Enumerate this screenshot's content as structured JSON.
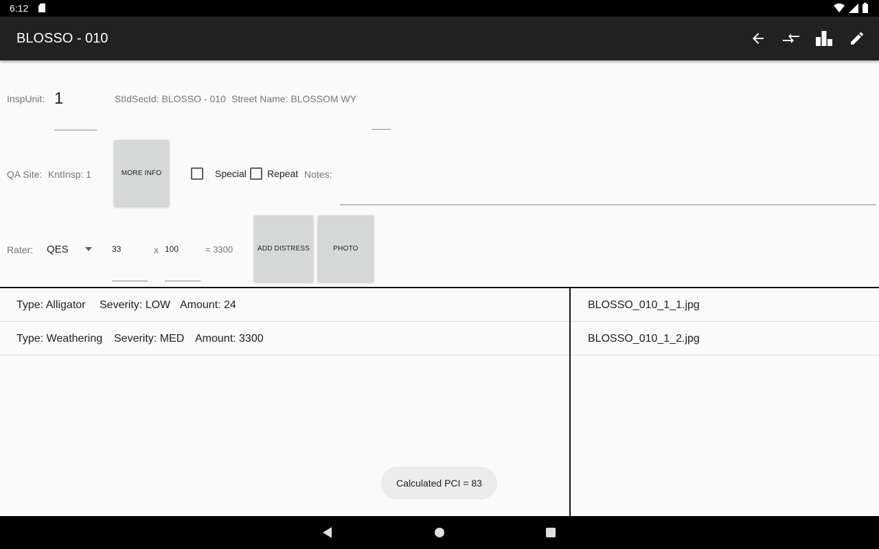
{
  "status_bar": {
    "time": "6:12"
  },
  "app_bar": {
    "title": "BLOSSO - 010"
  },
  "form": {
    "insp_unit_label": "InspUnit:",
    "insp_unit_value": "1",
    "stid_secid": "StIdSecId: BLOSSO - 010",
    "street_name": "Street Name: BLOSSOM WY",
    "qa_site_label": "QA Site:",
    "knt_insp": "KntInsp: 1",
    "more_info_label": "MORE INFO",
    "special_label": "Special",
    "repeat_label": "Repeat",
    "notes_label": "Notes:",
    "rater_label": "Rater:",
    "rater_value": "QES",
    "length_value": "33",
    "times_sign": "x",
    "width_value": "100",
    "area_result": "= 3300",
    "add_distress_label": "ADD DISTRESS",
    "photo_label": "PHOTO"
  },
  "distresses": [
    {
      "type": "Type: Alligator",
      "severity": "Severity: LOW",
      "amount": "Amount: 24"
    },
    {
      "type": "Type: Weathering",
      "severity": "Severity: MED",
      "amount": "Amount: 3300"
    }
  ],
  "photos": [
    "BLOSSO_010_1_1.jpg",
    "BLOSSO_010_1_2.jpg"
  ],
  "toast": "Calculated PCI = 83"
}
